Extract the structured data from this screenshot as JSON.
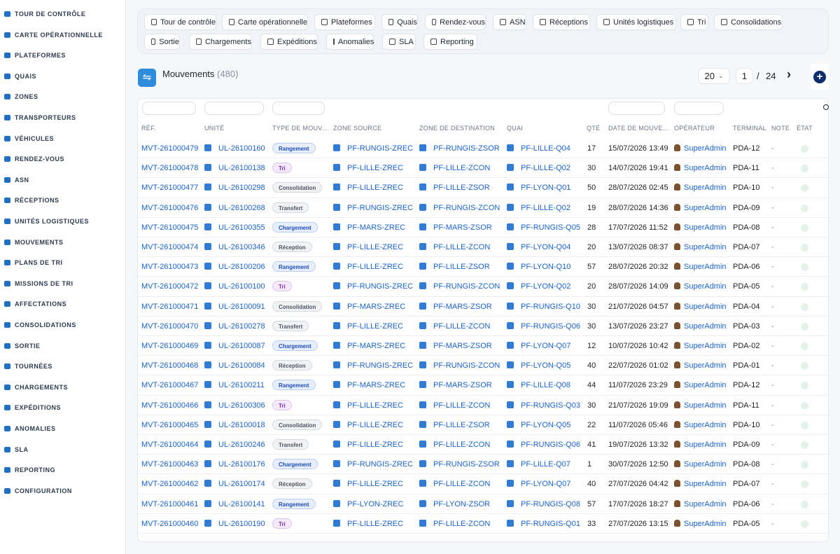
{
  "sidebar": {
    "items": [
      {
        "label": "TOUR DE CONTRÔLE",
        "icon": "gauge-icon"
      },
      {
        "label": "CARTE OPÉRATIONNELLE",
        "icon": "map-icon"
      },
      {
        "label": "PLATEFORMES",
        "icon": "warehouse-icon"
      },
      {
        "label": "QUAIS",
        "icon": "dock-icon"
      },
      {
        "label": "ZONES",
        "icon": "grid-icon"
      },
      {
        "label": "TRANSPORTEURS",
        "icon": "truck-icon"
      },
      {
        "label": "VÉHICULES",
        "icon": "bus-icon"
      },
      {
        "label": "RENDEZ-VOUS",
        "icon": "calendar-icon"
      },
      {
        "label": "ASN",
        "icon": "file-icon"
      },
      {
        "label": "RÉCEPTIONS",
        "icon": "cart-icon"
      },
      {
        "label": "UNITÉS LOGISTIQUES",
        "icon": "pallet-icon"
      },
      {
        "label": "MOUVEMENTS",
        "icon": "arrows-icon"
      },
      {
        "label": "PLANS DE TRI",
        "icon": "sitemap-icon"
      },
      {
        "label": "MISSIONS DE TRI",
        "icon": "list-icon"
      },
      {
        "label": "AFFECTATIONS",
        "icon": "shuffle-icon"
      },
      {
        "label": "CONSOLIDATIONS",
        "icon": "layers-icon"
      },
      {
        "label": "SORTIE",
        "icon": "export-icon"
      },
      {
        "label": "TOURNÉES",
        "icon": "route-icon"
      },
      {
        "label": "CHARGEMENTS",
        "icon": "truck-loading-icon"
      },
      {
        "label": "EXPÉDITIONS",
        "icon": "shipping-icon"
      },
      {
        "label": "ANOMALIES",
        "icon": "warning-icon"
      },
      {
        "label": "SLA",
        "icon": "stopwatch-icon"
      },
      {
        "label": "REPORTING",
        "icon": "chart-pie-icon"
      },
      {
        "label": "CONFIGURATION",
        "icon": "gear-icon"
      }
    ]
  },
  "topnav": {
    "chips": [
      {
        "label": "Tour de contrôle",
        "icon": "gauge-icon"
      },
      {
        "label": "Carte opérationnelle",
        "icon": "map-icon"
      },
      {
        "label": "Plateformes",
        "icon": "warehouse-icon"
      },
      {
        "label": "Quais",
        "icon": "dock-icon"
      },
      {
        "label": "Rendez-vous",
        "icon": "calendar-icon"
      },
      {
        "label": "ASN",
        "icon": "file-icon"
      },
      {
        "label": "Réceptions",
        "icon": "cart-icon"
      },
      {
        "label": "Unités logistiques",
        "icon": "pallet-icon"
      },
      {
        "label": "Tri",
        "icon": "list-icon"
      },
      {
        "label": "Consolidations",
        "icon": "layers-icon"
      },
      {
        "label": "Sortie",
        "icon": "export-icon"
      },
      {
        "label": "Chargements",
        "icon": "truck-loading-icon"
      },
      {
        "label": "Expéditions",
        "icon": "shipping-icon"
      },
      {
        "label": "Anomalies",
        "icon": "warning-icon"
      },
      {
        "label": "SLA",
        "icon": "stopwatch-icon"
      },
      {
        "label": "Reporting",
        "icon": "chart-pie-icon"
      }
    ]
  },
  "header": {
    "title": "Mouvements",
    "count": "(480)",
    "page_size": "20",
    "page": "1",
    "separator": "/",
    "total_pages": "24",
    "header_icon": "dolly-icon",
    "add_icon": "plus-circle-icon"
  },
  "table": {
    "columns": [
      "RÉF.",
      "UNITÉ",
      "TYPE DE MOUV...",
      "ZONE SOURCE",
      "ZONE DE DESTINATION",
      "QUAI",
      "QTÉ",
      "DATE DE MOUVE...",
      "OPÉRATEUR",
      "TERMINAL",
      "NOTE",
      "ÉTAT"
    ],
    "search_icon": "search-icon",
    "rows": [
      {
        "ref": "MVT-261000479",
        "unit": "UL-26100160",
        "type": "Rangement",
        "src": "PF-RUNGIS-ZREC",
        "dst": "PF-RUNGIS-ZSOR",
        "dock": "PF-LILLE-Q04",
        "qty": "17",
        "date": "15/07/2026 13:49",
        "op": "SuperAdmin",
        "term": "PDA-12",
        "note": "-"
      },
      {
        "ref": "MVT-261000478",
        "unit": "UL-26100138",
        "type": "Tri",
        "src": "PF-LILLE-ZREC",
        "dst": "PF-LILLE-ZCON",
        "dock": "PF-LILLE-Q02",
        "qty": "30",
        "date": "14/07/2026 19:41",
        "op": "SuperAdmin",
        "term": "PDA-11",
        "note": "-"
      },
      {
        "ref": "MVT-261000477",
        "unit": "UL-26100298",
        "type": "Consolidation",
        "src": "PF-LILLE-ZREC",
        "dst": "PF-LILLE-ZSOR",
        "dock": "PF-LYON-Q01",
        "qty": "50",
        "date": "28/07/2026 02:45",
        "op": "SuperAdmin",
        "term": "PDA-10",
        "note": "-"
      },
      {
        "ref": "MVT-261000476",
        "unit": "UL-26100268",
        "type": "Transfert",
        "src": "PF-RUNGIS-ZREC",
        "dst": "PF-RUNGIS-ZCON",
        "dock": "PF-LILLE-Q02",
        "qty": "19",
        "date": "28/07/2026 14:36",
        "op": "SuperAdmin",
        "term": "PDA-09",
        "note": "-"
      },
      {
        "ref": "MVT-261000475",
        "unit": "UL-26100355",
        "type": "Chargement",
        "src": "PF-MARS-ZREC",
        "dst": "PF-MARS-ZSOR",
        "dock": "PF-RUNGIS-Q05",
        "qty": "28",
        "date": "17/07/2026 11:52",
        "op": "SuperAdmin",
        "term": "PDA-08",
        "note": "-"
      },
      {
        "ref": "MVT-261000474",
        "unit": "UL-26100346",
        "type": "Réception",
        "src": "PF-LILLE-ZREC",
        "dst": "PF-LILLE-ZCON",
        "dock": "PF-LYON-Q04",
        "qty": "20",
        "date": "13/07/2026 08:37",
        "op": "SuperAdmin",
        "term": "PDA-07",
        "note": "-"
      },
      {
        "ref": "MVT-261000473",
        "unit": "UL-26100206",
        "type": "Rangement",
        "src": "PF-LILLE-ZREC",
        "dst": "PF-LILLE-ZSOR",
        "dock": "PF-LYON-Q10",
        "qty": "57",
        "date": "28/07/2026 20:32",
        "op": "SuperAdmin",
        "term": "PDA-06",
        "note": "-"
      },
      {
        "ref": "MVT-261000472",
        "unit": "UL-26100100",
        "type": "Tri",
        "src": "PF-RUNGIS-ZREC",
        "dst": "PF-RUNGIS-ZCON",
        "dock": "PF-LYON-Q02",
        "qty": "20",
        "date": "28/07/2026 14:09",
        "op": "SuperAdmin",
        "term": "PDA-05",
        "note": "-"
      },
      {
        "ref": "MVT-261000471",
        "unit": "UL-26100091",
        "type": "Consolidation",
        "src": "PF-MARS-ZREC",
        "dst": "PF-MARS-ZSOR",
        "dock": "PF-RUNGIS-Q10",
        "qty": "30",
        "date": "21/07/2026 04:57",
        "op": "SuperAdmin",
        "term": "PDA-04",
        "note": "-"
      },
      {
        "ref": "MVT-261000470",
        "unit": "UL-26100278",
        "type": "Transfert",
        "src": "PF-LILLE-ZREC",
        "dst": "PF-LILLE-ZCON",
        "dock": "PF-RUNGIS-Q06",
        "qty": "30",
        "date": "13/07/2026 23:27",
        "op": "SuperAdmin",
        "term": "PDA-03",
        "note": "-"
      },
      {
        "ref": "MVT-261000469",
        "unit": "UL-26100087",
        "type": "Chargement",
        "src": "PF-MARS-ZREC",
        "dst": "PF-MARS-ZSOR",
        "dock": "PF-LYON-Q07",
        "qty": "12",
        "date": "10/07/2026 10:42",
        "op": "SuperAdmin",
        "term": "PDA-02",
        "note": "-"
      },
      {
        "ref": "MVT-261000468",
        "unit": "UL-26100084",
        "type": "Réception",
        "src": "PF-RUNGIS-ZREC",
        "dst": "PF-RUNGIS-ZCON",
        "dock": "PF-LYON-Q05",
        "qty": "40",
        "date": "22/07/2026 01:02",
        "op": "SuperAdmin",
        "term": "PDA-01",
        "note": "-"
      },
      {
        "ref": "MVT-261000467",
        "unit": "UL-26100211",
        "type": "Rangement",
        "src": "PF-MARS-ZREC",
        "dst": "PF-MARS-ZSOR",
        "dock": "PF-LILLE-Q08",
        "qty": "44",
        "date": "11/07/2026 23:29",
        "op": "SuperAdmin",
        "term": "PDA-12",
        "note": "-"
      },
      {
        "ref": "MVT-261000466",
        "unit": "UL-26100306",
        "type": "Tri",
        "src": "PF-LILLE-ZREC",
        "dst": "PF-LILLE-ZCON",
        "dock": "PF-RUNGIS-Q03",
        "qty": "30",
        "date": "21/07/2026 19:09",
        "op": "SuperAdmin",
        "term": "PDA-11",
        "note": "-"
      },
      {
        "ref": "MVT-261000465",
        "unit": "UL-26100018",
        "type": "Consolidation",
        "src": "PF-LILLE-ZREC",
        "dst": "PF-LILLE-ZSOR",
        "dock": "PF-LYON-Q05",
        "qty": "22",
        "date": "11/07/2026 05:46",
        "op": "SuperAdmin",
        "term": "PDA-10",
        "note": "-"
      },
      {
        "ref": "MVT-261000464",
        "unit": "UL-26100246",
        "type": "Transfert",
        "src": "PF-LILLE-ZREC",
        "dst": "PF-LILLE-ZCON",
        "dock": "PF-RUNGIS-Q06",
        "qty": "41",
        "date": "19/07/2026 13:32",
        "op": "SuperAdmin",
        "term": "PDA-09",
        "note": "-"
      },
      {
        "ref": "MVT-261000463",
        "unit": "UL-26100176",
        "type": "Chargement",
        "src": "PF-RUNGIS-ZREC",
        "dst": "PF-RUNGIS-ZSOR",
        "dock": "PF-LILLE-Q07",
        "qty": "1",
        "date": "30/07/2026 12:50",
        "op": "SuperAdmin",
        "term": "PDA-08",
        "note": "-"
      },
      {
        "ref": "MVT-261000462",
        "unit": "UL-26100174",
        "type": "Réception",
        "src": "PF-LILLE-ZREC",
        "dst": "PF-LILLE-ZCON",
        "dock": "PF-LYON-Q07",
        "qty": "40",
        "date": "27/07/2026 04:42",
        "op": "SuperAdmin",
        "term": "PDA-07",
        "note": "-"
      },
      {
        "ref": "MVT-261000461",
        "unit": "UL-26100141",
        "type": "Rangement",
        "src": "PF-LYON-ZREC",
        "dst": "PF-LYON-ZSOR",
        "dock": "PF-RUNGIS-Q08",
        "qty": "57",
        "date": "17/07/2026 18:27",
        "op": "SuperAdmin",
        "term": "PDA-06",
        "note": "-"
      },
      {
        "ref": "MVT-261000460",
        "unit": "UL-26100190",
        "type": "Tri",
        "src": "PF-LILLE-ZREC",
        "dst": "PF-LILLE-ZCON",
        "dock": "PF-RUNGIS-Q01",
        "qty": "33",
        "date": "27/07/2026 13:15",
        "op": "SuperAdmin",
        "term": "PDA-05",
        "note": "-"
      }
    ]
  },
  "type_colors": {
    "Rangement": {
      "bg": "#e7efff",
      "fg": "#1f4db3",
      "border": "#b9cdf5"
    },
    "Tri": {
      "bg": "#f5eafc",
      "fg": "#7a2fb5",
      "border": "#dcc4f0"
    },
    "Consolidation": {
      "bg": "#f1f2f4",
      "fg": "#4e5560",
      "border": "#d5d8de"
    },
    "Transfert": {
      "bg": "#f1f2f4",
      "fg": "#4e5560",
      "border": "#d5d8de"
    },
    "Chargement": {
      "bg": "#e7efff",
      "fg": "#1f4db3",
      "border": "#b9cdf5"
    },
    "Réception": {
      "bg": "#f1f2f4",
      "fg": "#4e5560",
      "border": "#d5d8de"
    }
  }
}
